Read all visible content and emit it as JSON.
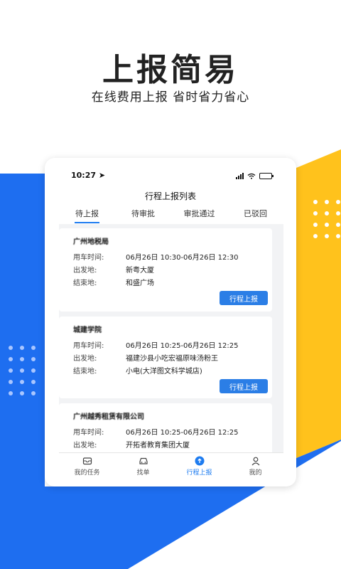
{
  "hero": {
    "title": "上报简易",
    "subtitle": "在线费用上报 省时省力省心"
  },
  "colors": {
    "blue": "#1e6ef0",
    "yellow": "#ffc21c",
    "button": "#2b7ee6"
  },
  "status_bar": {
    "time": "10:27",
    "location_icon": "location-arrow-icon"
  },
  "nav": {
    "title": "行程上报列表"
  },
  "tabs": [
    {
      "label": "待上报",
      "active": true
    },
    {
      "label": "待审批",
      "active": false
    },
    {
      "label": "审批通过",
      "active": false
    },
    {
      "label": "已驳回",
      "active": false
    }
  ],
  "cards": [
    {
      "title": "广州地税局",
      "rows": [
        {
          "k": "用车时间:",
          "v": "06月26日 10:30-06月26日 12:30"
        },
        {
          "k": "出发地:",
          "v": "新粤大厦"
        },
        {
          "k": "结束地:",
          "v": "和盛广场"
        }
      ],
      "button": "行程上报"
    },
    {
      "title": "城建学院",
      "rows": [
        {
          "k": "用车时间:",
          "v": "06月26日 10:25-06月26日 12:25"
        },
        {
          "k": "出发地:",
          "v": "福建沙县小吃宏福原味汤粉王"
        },
        {
          "k": "结束地:",
          "v": "小电(大洋图文科学城店)"
        }
      ],
      "button": "行程上报"
    },
    {
      "title": "广州越秀租赁有限公司",
      "rows": [
        {
          "k": "用车时间:",
          "v": "06月26日 10:25-06月26日 12:25"
        },
        {
          "k": "出发地:",
          "v": "开拓者教育集团大厦"
        }
      ],
      "button": ""
    }
  ],
  "tabbar": [
    {
      "label": "我的任务",
      "icon": "mail-icon",
      "active": false
    },
    {
      "label": "找单",
      "icon": "car-icon",
      "active": false
    },
    {
      "label": "行程上报",
      "icon": "upload-circle-icon",
      "active": true
    },
    {
      "label": "我的",
      "icon": "user-icon",
      "active": false
    }
  ]
}
